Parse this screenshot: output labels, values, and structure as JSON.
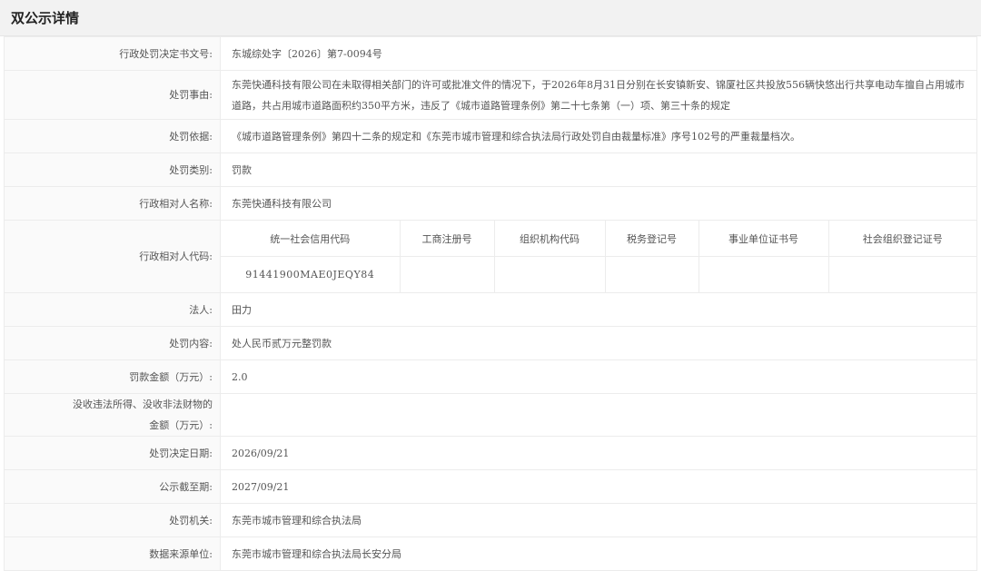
{
  "page": {
    "title": "双公示详情"
  },
  "fields": {
    "decision_no": {
      "label": "行政处罚决定书文号:",
      "value": "东城综处字〔2026〕第7-0094号"
    },
    "cause": {
      "label": "处罚事由:",
      "value": "东莞快通科技有限公司在未取得相关部门的许可或批准文件的情况下，于2026年8月31日分别在长安镇新安、锦厦社区共投放556辆快悠出行共享电动车擅自占用城市道路，共占用城市道路面积约350平方米，违反了《城市道路管理条例》第二十七条第（一）项、第三十条的规定"
    },
    "basis": {
      "label": "处罚依据:",
      "value": "《城市道路管理条例》第四十二条的规定和《东莞市城市管理和综合执法局行政处罚自由裁量标准》序号102号的严重裁量档次。"
    },
    "category": {
      "label": "处罚类别:",
      "value": "罚款"
    },
    "party_name": {
      "label": "行政相对人名称:",
      "value": "东莞快通科技有限公司"
    },
    "party_code": {
      "label": "行政相对人代码:",
      "headers": [
        "统一社会信用代码",
        "工商注册号",
        "组织机构代码",
        "税务登记号",
        "事业单位证书号",
        "社会组织登记证号"
      ],
      "values": [
        "91441900MAE0JEQY84",
        "",
        "",
        "",
        "",
        ""
      ]
    },
    "legal_person": {
      "label": "法人:",
      "value": "田力"
    },
    "content": {
      "label": "处罚内容:",
      "value": "处人民币贰万元整罚款"
    },
    "fine": {
      "label": "罚款金额（万元）:",
      "value": "2.0"
    },
    "confiscation": {
      "label_line1": "没收违法所得、没收非法财物的",
      "label_line2": "金额（万元）:",
      "value": ""
    },
    "decision_date": {
      "label": "处罚决定日期:",
      "value": "2026/09/21"
    },
    "publish_until": {
      "label": "公示截至期:",
      "value": "2027/09/21"
    },
    "authority": {
      "label": "处罚机关:",
      "value": "东莞市城市管理和综合执法局"
    },
    "source": {
      "label": "数据来源单位:",
      "value": "东莞市城市管理和综合执法局长安分局"
    }
  }
}
